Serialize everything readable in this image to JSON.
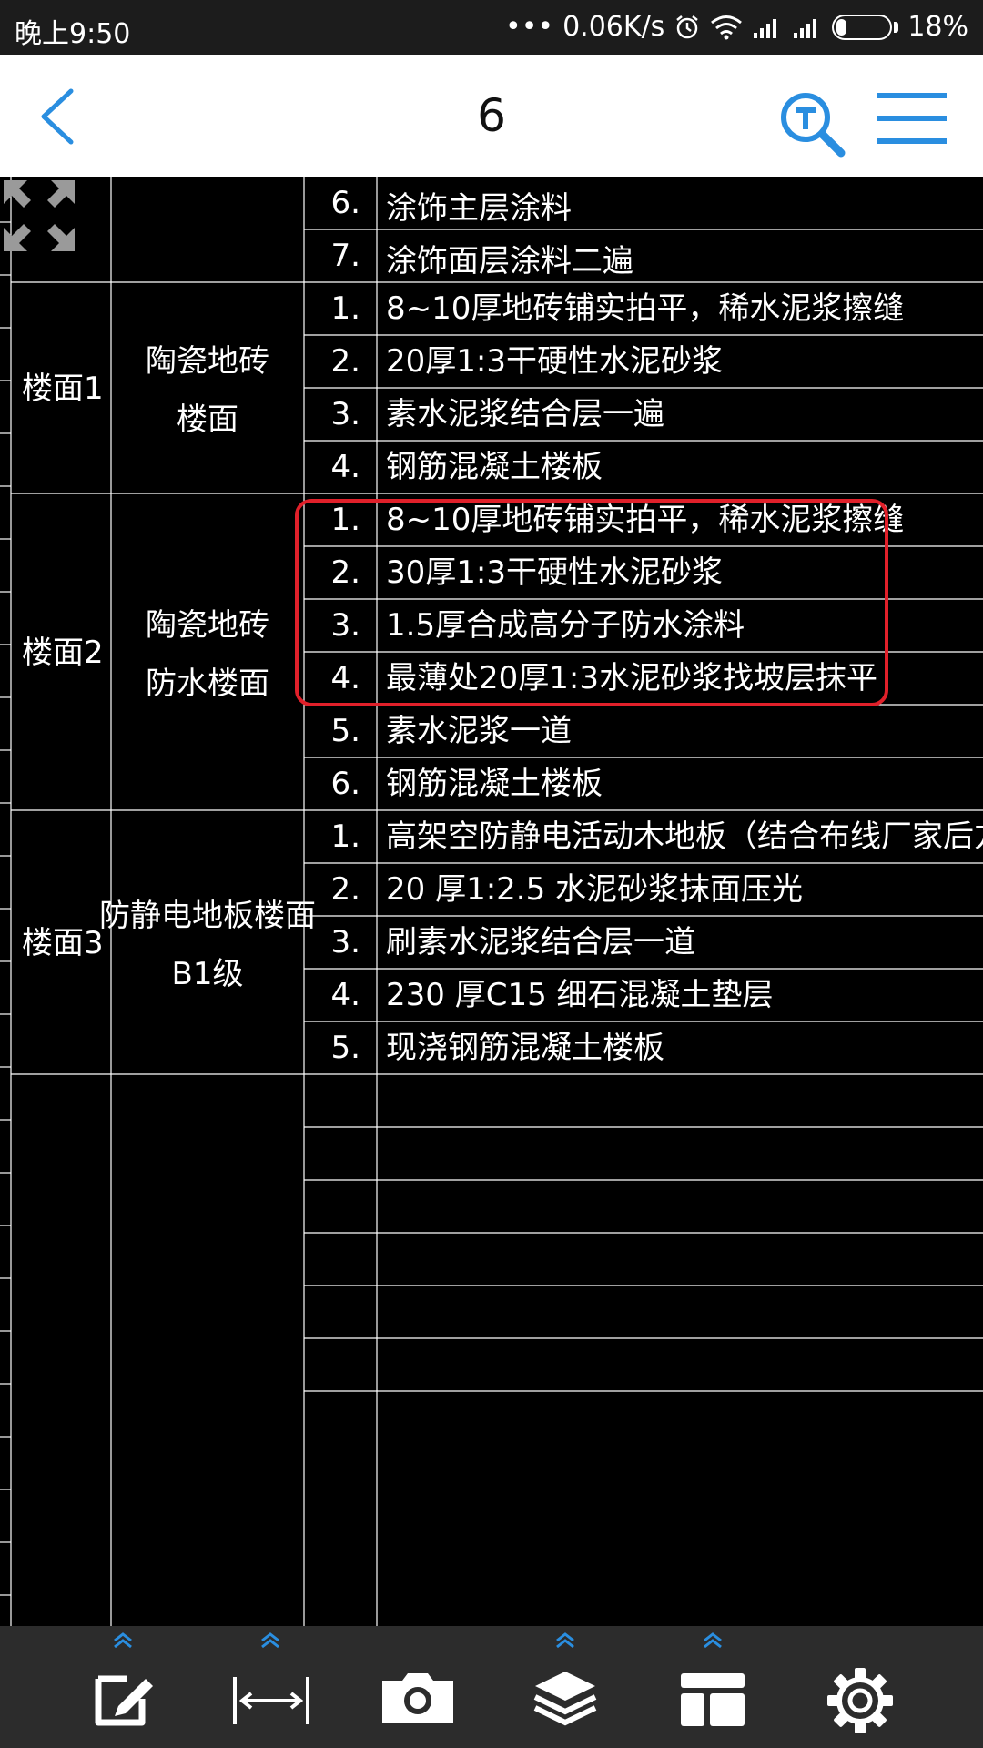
{
  "status_bar": {
    "time": "晚上9:50",
    "dots": "•••",
    "speed": "0.06K/s",
    "battery": "18%",
    "battery_level": 0.18,
    "icons": [
      "alarm-icon",
      "wifi-icon",
      "signal-icon",
      "signal-icon",
      "battery-icon"
    ]
  },
  "header": {
    "title": "6",
    "icons": [
      "back-arrow-icon",
      "text-search-icon",
      "menu-icon"
    ]
  },
  "drawing": {
    "top_rows": [
      {
        "num": "6.",
        "text": "涂饰主层涂料"
      },
      {
        "num": "7.",
        "text": "涂饰面层涂料二遍"
      }
    ],
    "groups": [
      {
        "code": "楼面1",
        "name_line1": "陶瓷地砖",
        "name_line2": "楼面",
        "rows": [
          {
            "num": "1.",
            "text": "8~10厚地砖铺实拍平，稀水泥浆擦缝"
          },
          {
            "num": "2.",
            "text": "20厚1:3干硬性水泥砂浆"
          },
          {
            "num": "3.",
            "text": "素水泥浆结合层一遍"
          },
          {
            "num": "4.",
            "text": "钢筋混凝土楼板"
          }
        ]
      },
      {
        "code": "楼面2",
        "name_line1": "陶瓷地砖",
        "name_line2": "防水楼面",
        "rows": [
          {
            "num": "1.",
            "text": "8~10厚地砖铺实拍平，稀水泥浆擦缝"
          },
          {
            "num": "2.",
            "text": "30厚1:3干硬性水泥砂浆"
          },
          {
            "num": "3.",
            "text": "1.5厚合成高分子防水涂料"
          },
          {
            "num": "4.",
            "text": "最薄处20厚1:3水泥砂浆找坡层抹平"
          },
          {
            "num": "5.",
            "text": "素水泥浆一道"
          },
          {
            "num": "6.",
            "text": "钢筋混凝土楼板"
          }
        ]
      },
      {
        "code": "楼面3",
        "name_line1": "防静电地板楼面",
        "name_line2": "B1级",
        "rows": [
          {
            "num": "1.",
            "text": "高架空防静电活动木地板（结合布线厂家后方可施"
          },
          {
            "num": "2.",
            "text": "20  厚1:2.5    水泥砂浆抹面压光"
          },
          {
            "num": "3.",
            "text": "刷素水泥浆结合层一道"
          },
          {
            "num": "4.",
            "text": "230  厚C15  细石混凝土垫层"
          },
          {
            "num": "5.",
            "text": "现浇钢筋混凝土楼板"
          }
        ]
      }
    ],
    "highlight_color": "#e0202a",
    "line_color": "#ffffff"
  },
  "toolbar": {
    "tools": [
      {
        "name": "annotate",
        "icon": "edit-icon",
        "has_expand": true
      },
      {
        "name": "measure",
        "icon": "measure-icon",
        "has_expand": true
      },
      {
        "name": "camera",
        "icon": "camera-icon",
        "has_expand": false
      },
      {
        "name": "layers",
        "icon": "layers-icon",
        "has_expand": true
      },
      {
        "name": "layout",
        "icon": "layout-icon",
        "has_expand": true
      },
      {
        "name": "settings",
        "icon": "gear-icon",
        "has_expand": false
      }
    ],
    "accent": "#2a8ee0"
  }
}
